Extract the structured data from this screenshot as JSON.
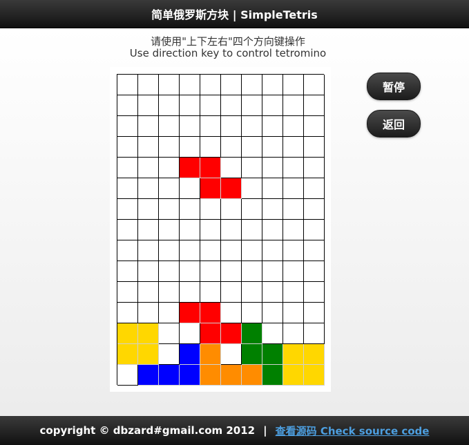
{
  "header": {
    "title": "简单俄罗斯方块 | SimpleTetris"
  },
  "instructions": {
    "line1": "请使用\"上下左右\"四个方向键操作",
    "line2": "Use direction key to control tetromino"
  },
  "buttons": {
    "pause": "暂停",
    "back": "返回"
  },
  "colors": {
    "R": "#ff0000",
    "Y": "#ffd700",
    "B": "#0000ff",
    "G": "#008000",
    "O": "#ff8c00"
  },
  "board": {
    "columns": 10,
    "rows": [
      "..........",
      "..........",
      "..........",
      "..........",
      "...RR.....",
      "....RR....",
      "..........",
      "..........",
      "..........",
      "..........",
      "..........",
      "...RR.....",
      "YY..RRG...",
      "YY.BO.GGYY",
      ".BBBOOOGYY"
    ]
  },
  "footer": {
    "copyright": "copyright © dbzard#gmail.com 2012",
    "separator": "|",
    "source_link": "查看源码 Check source code"
  }
}
